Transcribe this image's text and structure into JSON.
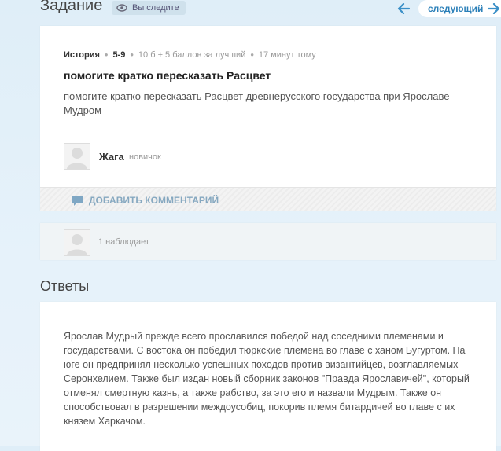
{
  "header": {
    "title": "Задание",
    "follow_label": "Вы следите",
    "next_label": "следующий"
  },
  "task": {
    "subject": "История",
    "grade": "5-9",
    "points": "10 б + 5 баллов за лучший",
    "time": "17 минут тому",
    "title": "помогите кратко пересказать Расцвет",
    "text": "помогите кратко пересказать Расцвет древнерусского государства при Ярославе Мудром",
    "author": "Жага",
    "author_rank": "новичок",
    "comment_label": "ДОБАВИТЬ КОММЕНТАРИЙ"
  },
  "watchers": {
    "text": "1 наблюдает"
  },
  "answers": {
    "title": "Ответы",
    "items": [
      {
        "text": "Ярослав Мудрый прежде всего прославился победой над соседними племенами и государствами. С востока он победил тюркские племена во главе с ханом Бугуртом. На юге он предпринял несколько успешных походов против византийцев, возглавляемых Серонхелием. Также был издан новый сборник законов \"Правда Ярославичей\", который отменял смертную казнь, а также рабство, за это его и назвали Мудрым. Также он способствовал в разрешении междоусобиц, покорив племя битардичей во главе с их князем Харкачом."
      }
    ]
  },
  "colors": {
    "accent": "#2a7fb8",
    "background": "#e3f0f9"
  }
}
